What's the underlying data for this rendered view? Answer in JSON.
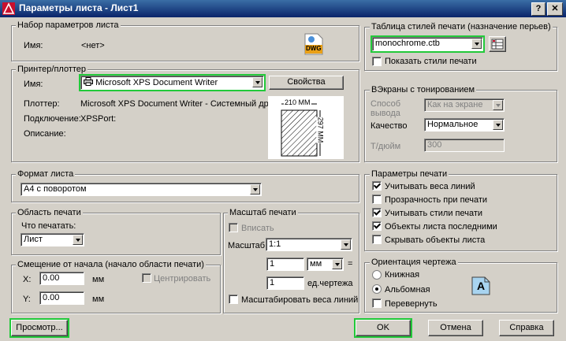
{
  "window": {
    "title": "Параметры листа - Лист1",
    "help": "?",
    "close": "✕"
  },
  "page_setup": {
    "group": "Набор параметров листа",
    "name_label": "Имя:",
    "name_value": "<нет>",
    "icon_text": "DWG"
  },
  "printer": {
    "group": "Принтер/плоттер",
    "name_label": "Имя:",
    "name_value": "Microsoft XPS Document Writer",
    "properties_button": "Свойства",
    "plotter_label": "Плоттер:",
    "plotter_value": "Microsoft XPS Document Writer - Системный дра...",
    "connection_label": "Подключение:",
    "connection_value": "XPSPort:",
    "description_label": "Описание:",
    "width_label": "210 MM",
    "height_label": "297 MM"
  },
  "paper": {
    "group": "Формат листа",
    "value": "А4 с поворотом"
  },
  "print_area": {
    "group": "Область печати",
    "what_label": "Что печатать:",
    "what_value": "Лист"
  },
  "offset": {
    "group": "Смещение от начала (начало области печати)",
    "x_label": "X:",
    "x_value": "0.00",
    "x_unit": "мм",
    "y_label": "Y:",
    "y_value": "0.00",
    "y_unit": "мм",
    "center_label": "Центрировать"
  },
  "scale": {
    "group": "Масштаб печати",
    "fit_label": "Вписать",
    "scale_label": "Масштаб:",
    "scale_value": "1:1",
    "val1": "1",
    "unit_value": "мм",
    "eq": "=",
    "val2": "1",
    "units_label": "ед.чертежа",
    "lineweights_label": "Масштабировать веса линий"
  },
  "plot_style": {
    "group": "Таблица стилей печати (назначение перьев)",
    "value": "monochrome.ctb",
    "show_label": "Показать стили печати"
  },
  "shaded": {
    "group": "ВЭкраны с тонированием",
    "mode_label_1": "Способ",
    "mode_label_2": "вывода",
    "mode_value": "Как на экране",
    "quality_label": "Качество",
    "quality_value": "Нормальное",
    "dpi_label": "Т/дюйм",
    "dpi_value": "300"
  },
  "print_options": {
    "group": "Параметры печати",
    "items": [
      {
        "label": "Учитывать веса линий",
        "checked": true
      },
      {
        "label": "Прозрачность при печати",
        "checked": false
      },
      {
        "label": "Учитывать стили печати",
        "checked": true
      },
      {
        "label": "Объекты листа последними",
        "checked": true
      },
      {
        "label": "Скрывать объекты листа",
        "checked": false
      }
    ]
  },
  "orientation": {
    "group": "Ориентация чертежа",
    "portrait": "Книжная",
    "landscape": "Альбомная",
    "upside": "Перевернуть",
    "icon_letter": "A"
  },
  "buttons": {
    "preview": "Просмотр...",
    "ok": "OK",
    "cancel": "Отмена",
    "help": "Справка"
  }
}
